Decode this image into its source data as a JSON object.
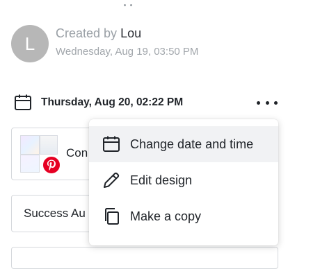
{
  "creator": {
    "avatar_initial": "L",
    "created_by_prefix": "Created by ",
    "created_by_name": "Lou",
    "created_date": "Wednesday, Aug 19, 03:50 PM"
  },
  "schedule": {
    "date_label": "Thursday, Aug 20, 02:22 PM",
    "icon": "calendar-icon",
    "more_icon": "more-horizontal-icon"
  },
  "cards": {
    "pin_label": "Con",
    "pin_badge_icon": "pinterest-icon",
    "board_label": "Success Au"
  },
  "menu": {
    "items": [
      {
        "label": "Change date and time",
        "icon": "calendar-icon"
      },
      {
        "label": "Edit design",
        "icon": "pencil-icon"
      },
      {
        "label": "Make a copy",
        "icon": "copy-icon"
      }
    ]
  },
  "colors": {
    "avatar_bg": "#b7b7b7",
    "muted_text": "#9aa0a6",
    "pinterest_red": "#e60023",
    "menu_hover": "#f1f2f4"
  }
}
